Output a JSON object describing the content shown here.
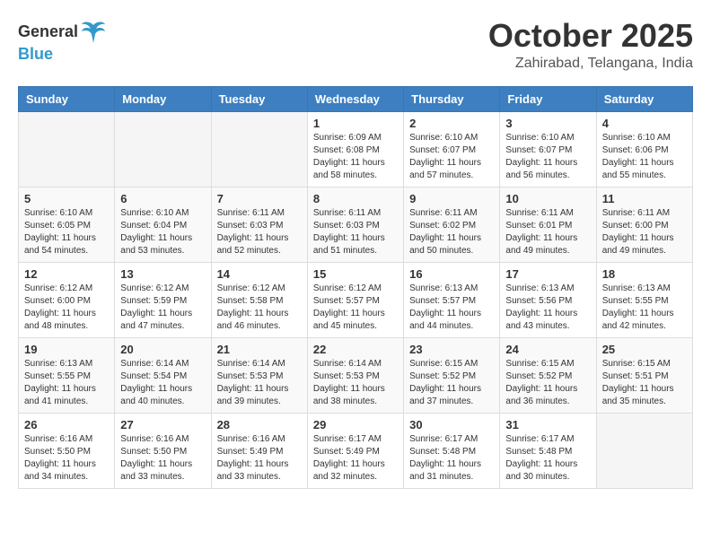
{
  "header": {
    "logo_general": "General",
    "logo_blue": "Blue",
    "month_year": "October 2025",
    "location": "Zahirabad, Telangana, India"
  },
  "weekdays": [
    "Sunday",
    "Monday",
    "Tuesday",
    "Wednesday",
    "Thursday",
    "Friday",
    "Saturday"
  ],
  "weeks": [
    [
      {
        "day": "",
        "sunrise": "",
        "sunset": "",
        "daylight": ""
      },
      {
        "day": "",
        "sunrise": "",
        "sunset": "",
        "daylight": ""
      },
      {
        "day": "",
        "sunrise": "",
        "sunset": "",
        "daylight": ""
      },
      {
        "day": "1",
        "sunrise": "Sunrise: 6:09 AM",
        "sunset": "Sunset: 6:08 PM",
        "daylight": "Daylight: 11 hours and 58 minutes."
      },
      {
        "day": "2",
        "sunrise": "Sunrise: 6:10 AM",
        "sunset": "Sunset: 6:07 PM",
        "daylight": "Daylight: 11 hours and 57 minutes."
      },
      {
        "day": "3",
        "sunrise": "Sunrise: 6:10 AM",
        "sunset": "Sunset: 6:07 PM",
        "daylight": "Daylight: 11 hours and 56 minutes."
      },
      {
        "day": "4",
        "sunrise": "Sunrise: 6:10 AM",
        "sunset": "Sunset: 6:06 PM",
        "daylight": "Daylight: 11 hours and 55 minutes."
      }
    ],
    [
      {
        "day": "5",
        "sunrise": "Sunrise: 6:10 AM",
        "sunset": "Sunset: 6:05 PM",
        "daylight": "Daylight: 11 hours and 54 minutes."
      },
      {
        "day": "6",
        "sunrise": "Sunrise: 6:10 AM",
        "sunset": "Sunset: 6:04 PM",
        "daylight": "Daylight: 11 hours and 53 minutes."
      },
      {
        "day": "7",
        "sunrise": "Sunrise: 6:11 AM",
        "sunset": "Sunset: 6:03 PM",
        "daylight": "Daylight: 11 hours and 52 minutes."
      },
      {
        "day": "8",
        "sunrise": "Sunrise: 6:11 AM",
        "sunset": "Sunset: 6:03 PM",
        "daylight": "Daylight: 11 hours and 51 minutes."
      },
      {
        "day": "9",
        "sunrise": "Sunrise: 6:11 AM",
        "sunset": "Sunset: 6:02 PM",
        "daylight": "Daylight: 11 hours and 50 minutes."
      },
      {
        "day": "10",
        "sunrise": "Sunrise: 6:11 AM",
        "sunset": "Sunset: 6:01 PM",
        "daylight": "Daylight: 11 hours and 49 minutes."
      },
      {
        "day": "11",
        "sunrise": "Sunrise: 6:11 AM",
        "sunset": "Sunset: 6:00 PM",
        "daylight": "Daylight: 11 hours and 49 minutes."
      }
    ],
    [
      {
        "day": "12",
        "sunrise": "Sunrise: 6:12 AM",
        "sunset": "Sunset: 6:00 PM",
        "daylight": "Daylight: 11 hours and 48 minutes."
      },
      {
        "day": "13",
        "sunrise": "Sunrise: 6:12 AM",
        "sunset": "Sunset: 5:59 PM",
        "daylight": "Daylight: 11 hours and 47 minutes."
      },
      {
        "day": "14",
        "sunrise": "Sunrise: 6:12 AM",
        "sunset": "Sunset: 5:58 PM",
        "daylight": "Daylight: 11 hours and 46 minutes."
      },
      {
        "day": "15",
        "sunrise": "Sunrise: 6:12 AM",
        "sunset": "Sunset: 5:57 PM",
        "daylight": "Daylight: 11 hours and 45 minutes."
      },
      {
        "day": "16",
        "sunrise": "Sunrise: 6:13 AM",
        "sunset": "Sunset: 5:57 PM",
        "daylight": "Daylight: 11 hours and 44 minutes."
      },
      {
        "day": "17",
        "sunrise": "Sunrise: 6:13 AM",
        "sunset": "Sunset: 5:56 PM",
        "daylight": "Daylight: 11 hours and 43 minutes."
      },
      {
        "day": "18",
        "sunrise": "Sunrise: 6:13 AM",
        "sunset": "Sunset: 5:55 PM",
        "daylight": "Daylight: 11 hours and 42 minutes."
      }
    ],
    [
      {
        "day": "19",
        "sunrise": "Sunrise: 6:13 AM",
        "sunset": "Sunset: 5:55 PM",
        "daylight": "Daylight: 11 hours and 41 minutes."
      },
      {
        "day": "20",
        "sunrise": "Sunrise: 6:14 AM",
        "sunset": "Sunset: 5:54 PM",
        "daylight": "Daylight: 11 hours and 40 minutes."
      },
      {
        "day": "21",
        "sunrise": "Sunrise: 6:14 AM",
        "sunset": "Sunset: 5:53 PM",
        "daylight": "Daylight: 11 hours and 39 minutes."
      },
      {
        "day": "22",
        "sunrise": "Sunrise: 6:14 AM",
        "sunset": "Sunset: 5:53 PM",
        "daylight": "Daylight: 11 hours and 38 minutes."
      },
      {
        "day": "23",
        "sunrise": "Sunrise: 6:15 AM",
        "sunset": "Sunset: 5:52 PM",
        "daylight": "Daylight: 11 hours and 37 minutes."
      },
      {
        "day": "24",
        "sunrise": "Sunrise: 6:15 AM",
        "sunset": "Sunset: 5:52 PM",
        "daylight": "Daylight: 11 hours and 36 minutes."
      },
      {
        "day": "25",
        "sunrise": "Sunrise: 6:15 AM",
        "sunset": "Sunset: 5:51 PM",
        "daylight": "Daylight: 11 hours and 35 minutes."
      }
    ],
    [
      {
        "day": "26",
        "sunrise": "Sunrise: 6:16 AM",
        "sunset": "Sunset: 5:50 PM",
        "daylight": "Daylight: 11 hours and 34 minutes."
      },
      {
        "day": "27",
        "sunrise": "Sunrise: 6:16 AM",
        "sunset": "Sunset: 5:50 PM",
        "daylight": "Daylight: 11 hours and 33 minutes."
      },
      {
        "day": "28",
        "sunrise": "Sunrise: 6:16 AM",
        "sunset": "Sunset: 5:49 PM",
        "daylight": "Daylight: 11 hours and 33 minutes."
      },
      {
        "day": "29",
        "sunrise": "Sunrise: 6:17 AM",
        "sunset": "Sunset: 5:49 PM",
        "daylight": "Daylight: 11 hours and 32 minutes."
      },
      {
        "day": "30",
        "sunrise": "Sunrise: 6:17 AM",
        "sunset": "Sunset: 5:48 PM",
        "daylight": "Daylight: 11 hours and 31 minutes."
      },
      {
        "day": "31",
        "sunrise": "Sunrise: 6:17 AM",
        "sunset": "Sunset: 5:48 PM",
        "daylight": "Daylight: 11 hours and 30 minutes."
      },
      {
        "day": "",
        "sunrise": "",
        "sunset": "",
        "daylight": ""
      }
    ]
  ]
}
